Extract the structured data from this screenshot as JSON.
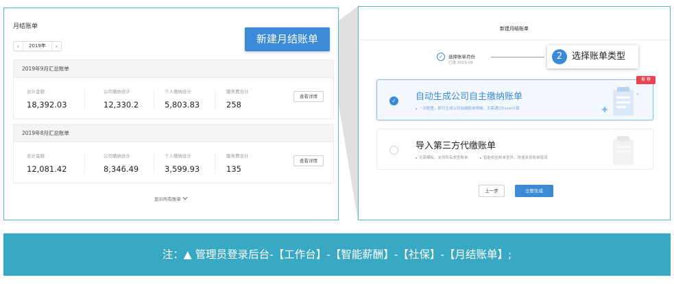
{
  "left": {
    "title": "月结账单",
    "year_picker": {
      "prev": "‹",
      "value": "2019年",
      "next": "›"
    },
    "labels": {
      "total": "合计金额",
      "company": "公司缴纳合计",
      "personal": "个人缴纳合计",
      "service": "服务费合计"
    },
    "bills": [
      {
        "header": "2019年9月汇总账单",
        "total": "18,392.03",
        "company": "12,330.2",
        "personal": "5,803.83",
        "service": "258",
        "button": "查看详情"
      },
      {
        "header": "2019年8月汇总账单",
        "total": "12,081.42",
        "company": "8,346.49",
        "personal": "3,599.93",
        "service": "135",
        "button": "查看详情"
      }
    ],
    "show_all": "显示所有账单",
    "show_all_icon": "chevron-down-icon"
  },
  "callout_left": "新建月结账单",
  "modal": {
    "title": "新建月结账单",
    "step1": {
      "title": "选择账单月份",
      "subtitle": "已选 2019-09"
    },
    "step2": {
      "number": "2",
      "title": "选择账单类型"
    },
    "options": [
      {
        "title": "自动生成公司自主缴纳账单",
        "desc": "一次配置，即可生成公司自缴账单明细，无需通过Excel计算",
        "tag": "推 荐",
        "selected": true
      },
      {
        "title": "导入第三方代缴账单",
        "desc1": "无需模板，支持所有类型账单",
        "desc2": "智能校验账单差异，快速发现账单错误",
        "selected": false
      }
    ],
    "buttons": {
      "prev": "上一步",
      "generate": "立即生成"
    }
  },
  "banner": "注：▲  管理员登录后台-【工作台】-【智能薪酬】-【社保】-【月结账单】;",
  "colors": {
    "accent": "#3a8ad6",
    "frame": "#58b6c9",
    "banner": "#39a8c2",
    "tag": "#e8434f"
  }
}
